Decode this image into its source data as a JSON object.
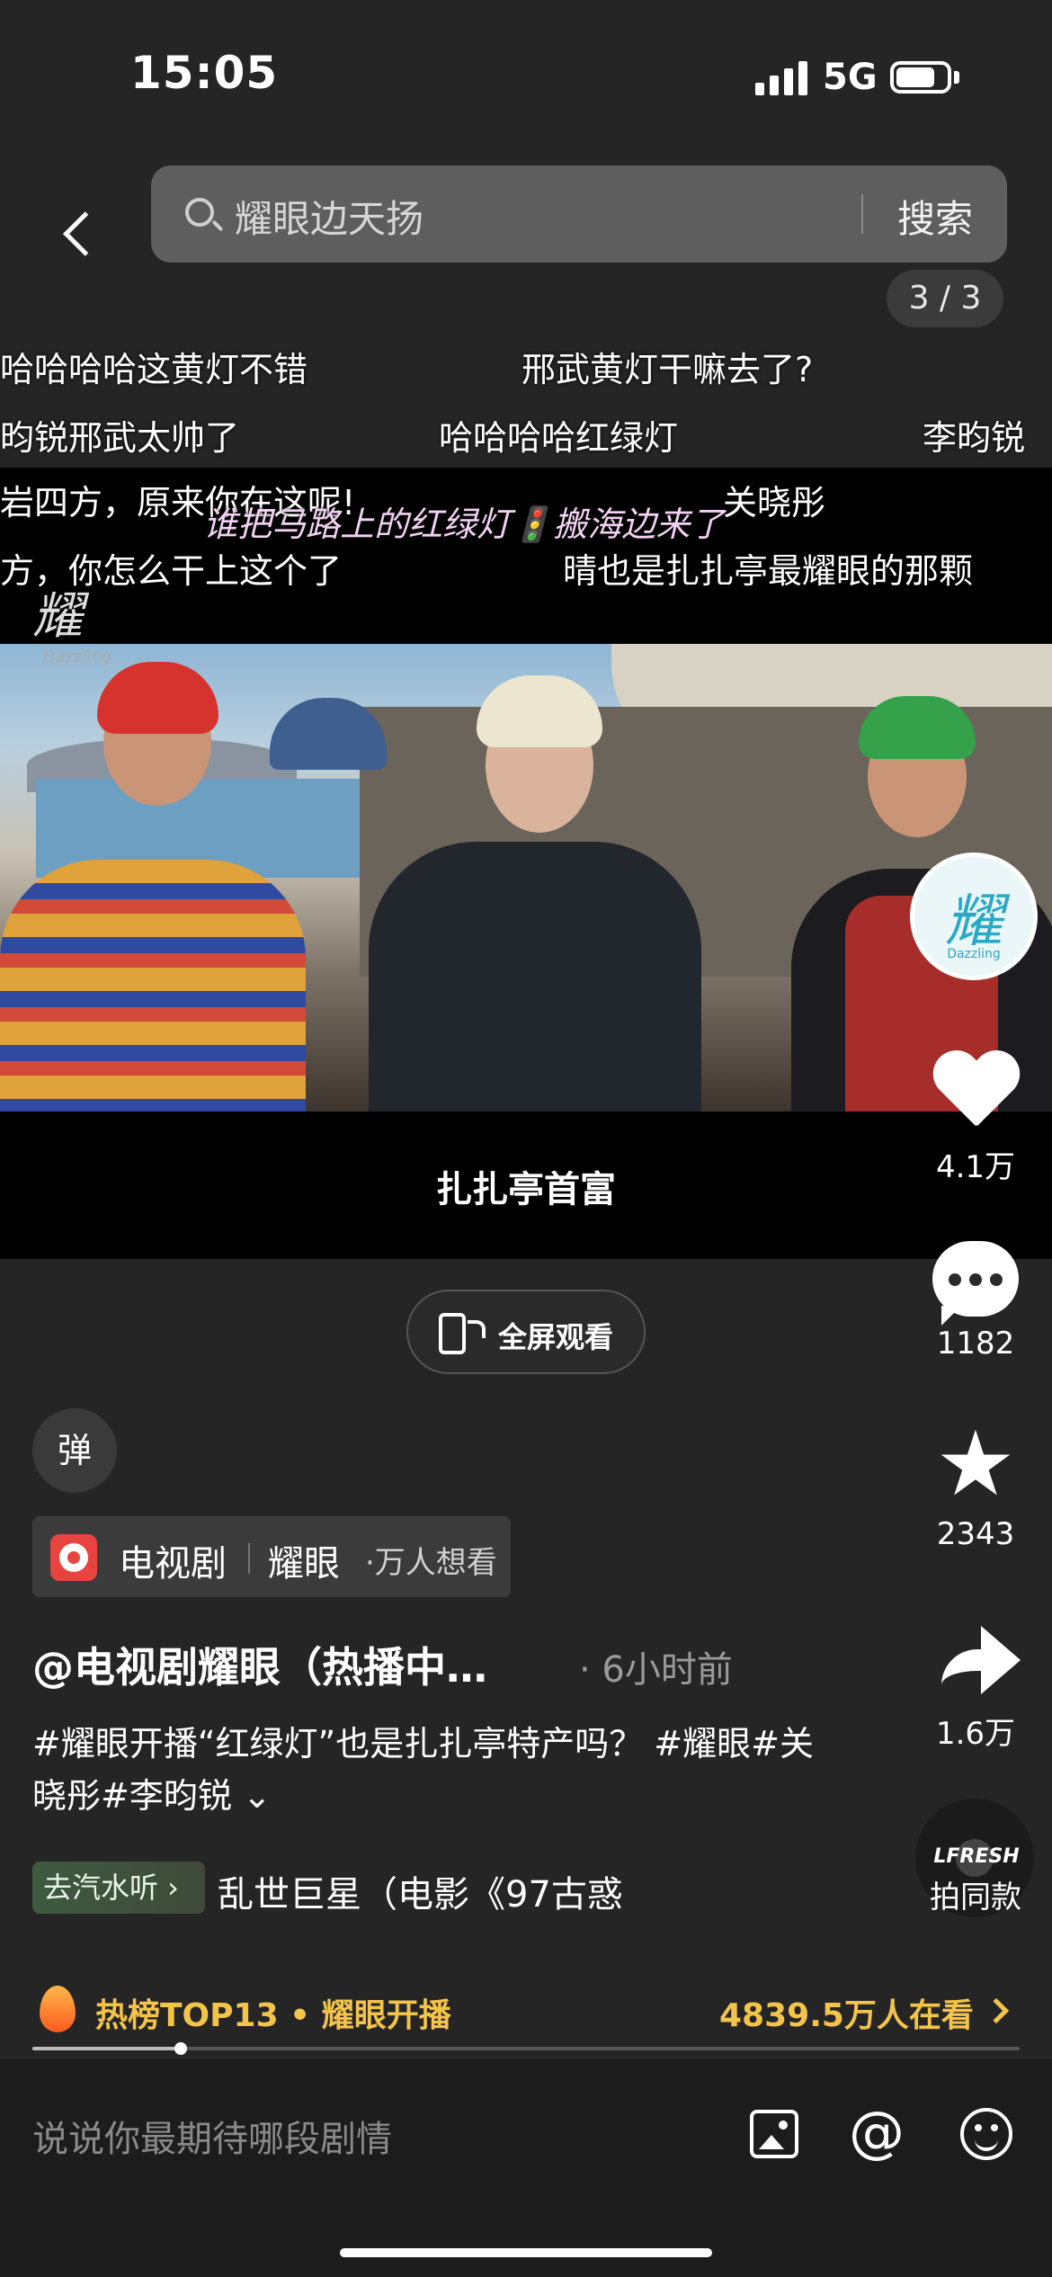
{
  "status_bar": {
    "time": "15:05",
    "network": "5G"
  },
  "search": {
    "query": "耀眼边天扬",
    "button": "搜索"
  },
  "page_indicator": "3 / 3",
  "danmaku": [
    "哈哈哈哈这黄灯不错",
    "邢武黄灯干嘛去了?",
    "昀锐邢武太帅了",
    "哈哈哈哈红绿灯",
    "李昀锐",
    "岩四方，原来你在这呢!",
    "关晓彤",
    "谁把马路上的红绿灯🚦搬海边来了",
    "方，你怎么干上这个了",
    "晴也是扎扎亭最耀眼的那颗"
  ],
  "video": {
    "logo": "耀",
    "logo_sub": "Dazzling",
    "subtitle": "扎扎亭首富"
  },
  "sidebar": {
    "avatar_logo": "耀",
    "avatar_logo_sub": "Dazzling",
    "likes": "4.1万",
    "comments": "1182",
    "favorites": "2343",
    "shares": "1.6万",
    "music_disc_label": "LFRESH",
    "music_disc_text": "拍同款"
  },
  "fullscreen_label": "全屏观看",
  "danmaku_toggle": "弹",
  "tag": {
    "label": "电视剧",
    "name": "耀眼",
    "meta": "·万人想看"
  },
  "author": "@电视剧耀眼（热播中…",
  "post_time": "· 6小时前",
  "caption": "#耀眼开播“红绿灯”也是扎扎亭特产吗？ #耀眼#关晓彤#李昀锐 ⌄",
  "music": {
    "chip": "去汽水听 ›",
    "title": "乱世巨星（电影《97古惑"
  },
  "hot": {
    "text": "热榜TOP13 • 耀眼开播",
    "count": "4839.5万人在看"
  },
  "progress": 0.15,
  "comment_placeholder": "说说你最期待哪段剧情",
  "icons": {
    "image": "image-icon",
    "mention": "at-icon",
    "emoji": "emoji-icon"
  }
}
